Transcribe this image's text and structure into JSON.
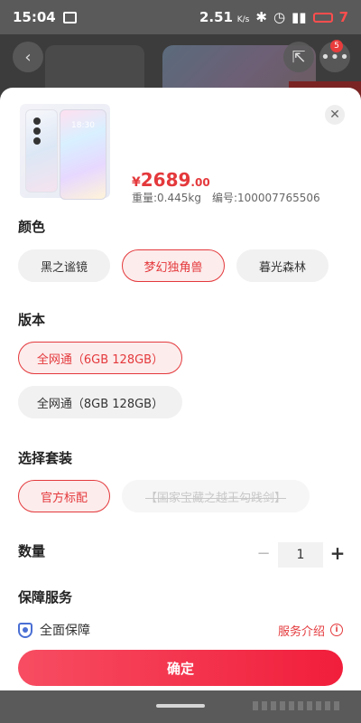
{
  "status_bar": {
    "time": "15:04",
    "speed": "2.51",
    "speed_unit": "K/s",
    "battery": "7"
  },
  "background": {
    "notification_badge": "5"
  },
  "product": {
    "currency": "¥",
    "price_integer": "2689",
    "price_decimal": ".00",
    "weight": "重量:0.445kg",
    "sku": "编号:100007765506",
    "screen_time": "18:30"
  },
  "sections": {
    "color_title": "颜色",
    "version_title": "版本",
    "package_title": "选择套装",
    "quantity_title": "数量",
    "service_title": "保障服务"
  },
  "colors": [
    {
      "label": "黑之谧镜",
      "selected": false
    },
    {
      "label": "梦幻独角兽",
      "selected": true
    },
    {
      "label": "暮光森林",
      "selected": false
    }
  ],
  "versions": [
    {
      "label": "全网通（6GB 128GB）",
      "selected": true
    },
    {
      "label": "全网通（8GB 128GB）",
      "selected": false
    }
  ],
  "packages": [
    {
      "label": "官方标配",
      "selected": true
    },
    {
      "label": "【国家宝藏之越王勾践剑】",
      "disabled": true
    }
  ],
  "quantity": {
    "minus": "−",
    "value": "1",
    "plus": "+"
  },
  "service": {
    "label": "全面保障",
    "link": "服务介绍",
    "info_icon": "i"
  },
  "confirm_label": "确定",
  "accent_color": "#e4393c"
}
